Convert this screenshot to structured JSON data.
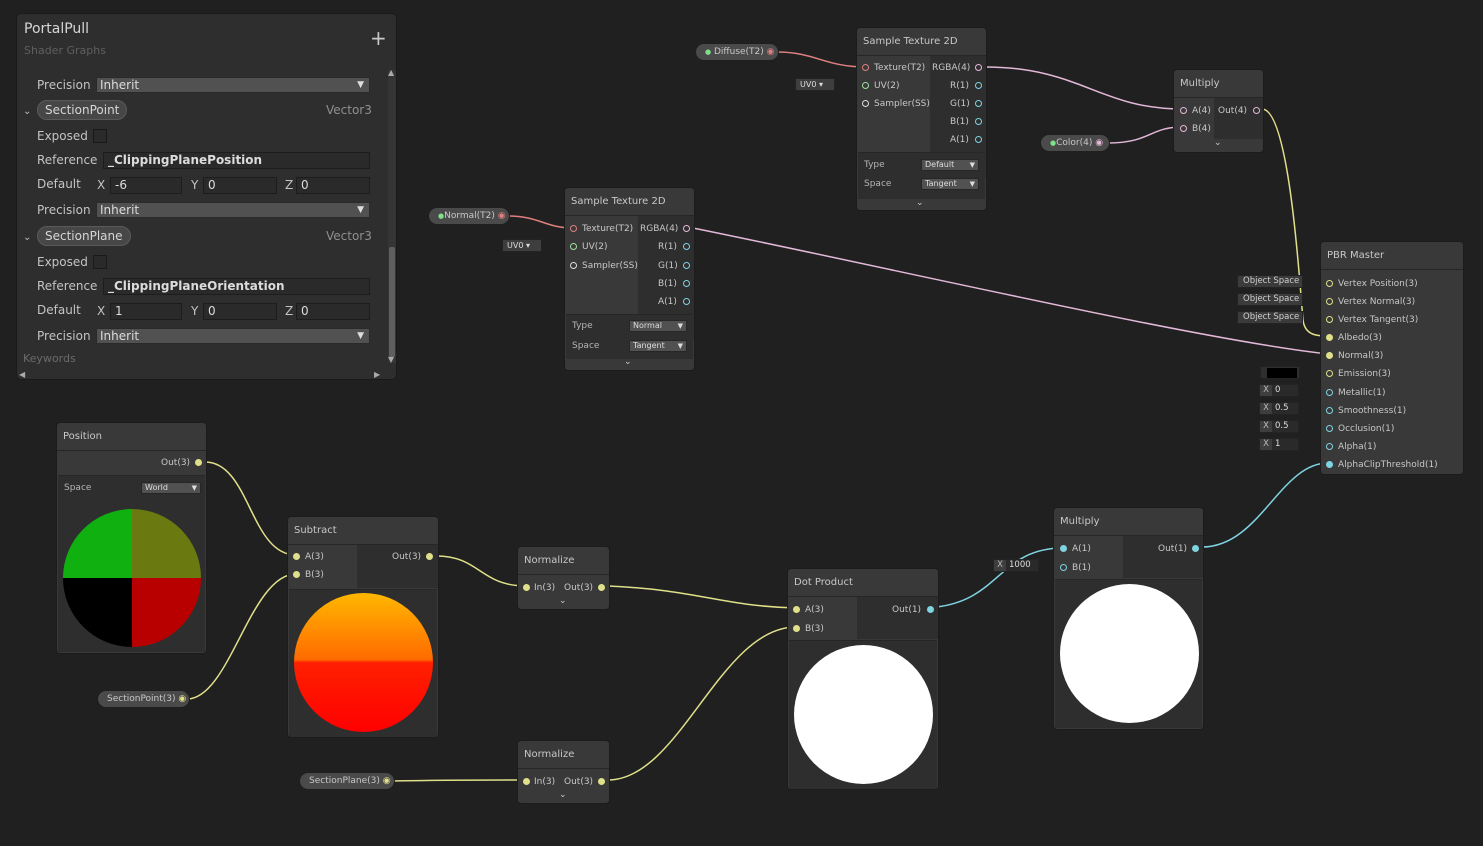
{
  "blackboard": {
    "title": "PortalPull",
    "subtitle": "Shader Graphs",
    "add_label": "+",
    "precision_label": "Precision",
    "inherit": "Inherit",
    "exposed_label": "Exposed",
    "reference_label": "Reference",
    "default_label": "Default",
    "keywords_label": "Keywords",
    "x": "X",
    "y": "Y",
    "z": "Z",
    "properties": [
      {
        "name": "SectionPoint",
        "type": "Vector3",
        "reference": "_ClippingPlanePosition",
        "x": "-6",
        "y": "0",
        "z": "0"
      },
      {
        "name": "SectionPlane",
        "type": "Vector3",
        "reference": "_ClippingPlaneOrientation",
        "x": "1",
        "y": "0",
        "z": "0"
      }
    ]
  },
  "nodes": {
    "sample_top": {
      "title": "Sample Texture 2D",
      "in": [
        "Texture(T2)",
        "UV(2)",
        "Sampler(SS)"
      ],
      "out": [
        "RGBA(4)",
        "R(1)",
        "G(1)",
        "B(1)",
        "A(1)"
      ],
      "type_label": "Type",
      "type_value": "Default",
      "space_label": "Space",
      "space_value": "Tangent"
    },
    "sample_mid": {
      "title": "Sample Texture 2D",
      "in": [
        "Texture(T2)",
        "UV(2)",
        "Sampler(SS)"
      ],
      "out": [
        "RGBA(4)",
        "R(1)",
        "G(1)",
        "B(1)",
        "A(1)"
      ],
      "type_label": "Type",
      "type_value": "Normal",
      "space_label": "Space",
      "space_value": "Tangent"
    },
    "multiply_top": {
      "title": "Multiply",
      "in": [
        "A(4)",
        "B(4)"
      ],
      "out": "Out(4)"
    },
    "pbr": {
      "title": "PBR Master",
      "in": [
        "Vertex Position(3)",
        "Vertex Normal(3)",
        "Vertex Tangent(3)",
        "Albedo(3)",
        "Normal(3)",
        "Emission(3)",
        "Metallic(1)",
        "Smoothness(1)",
        "Occlusion(1)",
        "Alpha(1)",
        "AlphaClipThreshold(1)"
      ],
      "object_space": "Object Space",
      "metallic": "0",
      "smoothness": "0.5",
      "occlusion": "0.5",
      "alpha": "1",
      "x": "X"
    },
    "position": {
      "title": "Position",
      "out": "Out(3)",
      "space_label": "Space",
      "space_value": "World"
    },
    "subtract": {
      "title": "Subtract",
      "in": [
        "A(3)",
        "B(3)"
      ],
      "out": "Out(3)"
    },
    "normalize1": {
      "title": "Normalize",
      "in": "In(3)",
      "out": "Out(3)"
    },
    "normalize2": {
      "title": "Normalize",
      "in": "In(3)",
      "out": "Out(3)"
    },
    "dot": {
      "title": "Dot Product",
      "in": [
        "A(3)",
        "B(3)"
      ],
      "out": "Out(1)"
    },
    "multiply_bot": {
      "title": "Multiply",
      "in": [
        "A(1)",
        "B(1)"
      ],
      "out": "Out(1)",
      "b_value": "1000",
      "x": "X"
    }
  },
  "properties": {
    "diffuse": "Diffuse(T2)",
    "normal": "Normal(T2)",
    "color": "Color(4)",
    "section_point": "SectionPoint(3)",
    "section_plane": "SectionPlane(3)",
    "uv0": "UV0"
  },
  "colors": {
    "background": "#202020",
    "node": "#393939",
    "wire_vec4": "#e3b8d8",
    "wire_vec3": "#e0e08a",
    "wire_float": "#7fd4e2",
    "wire_texture": "#e07f7f"
  }
}
